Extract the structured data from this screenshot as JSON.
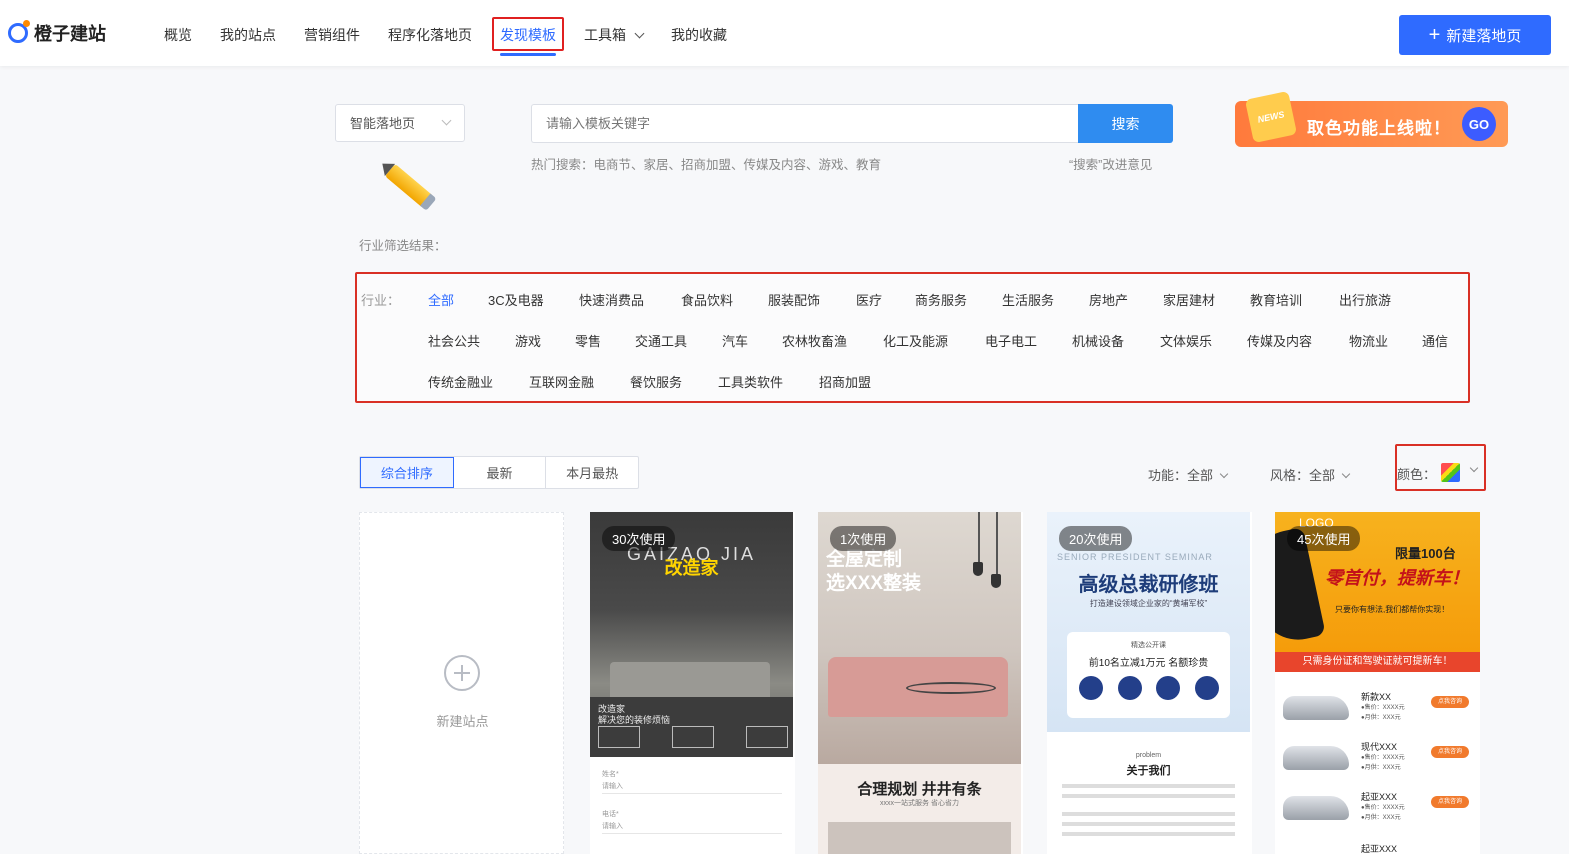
{
  "header": {
    "logo_text": "橙子建站",
    "nav": [
      "概览",
      "我的站点",
      "营销组件",
      "程序化落地页",
      "发现模板",
      "工具箱",
      "我的收藏"
    ],
    "active_nav": "发现模板",
    "new_button": "新建落地页"
  },
  "search": {
    "scope_select": "智能落地页",
    "placeholder": "请输入模板关键字",
    "button": "搜索",
    "hot_label": "热门搜索：电商节、家居、招商加盟、传媒及内容、游戏、教育",
    "feedback": "“搜索”改进意见"
  },
  "promo": {
    "badge": "NEWS",
    "text": "取色功能上线啦！",
    "go": "GO"
  },
  "filter_result_label": "行业筛选结果：",
  "industry": {
    "label": "行业：",
    "active": "全部",
    "rows": [
      [
        "全部",
        "3C及电器",
        "快速消费品",
        "食品饮料",
        "服装配饰",
        "医疗",
        "商务服务",
        "生活服务",
        "房地产",
        "家居建材",
        "教育培训",
        "出行旅游"
      ],
      [
        "社会公共",
        "游戏",
        "零售",
        "交通工具",
        "汽车",
        "农林牧畜渔",
        "化工及能源",
        "电子电工",
        "机械设备",
        "文体娱乐",
        "传媒及内容",
        "物流业",
        "通信"
      ],
      [
        "传统金融业",
        "互联网金融",
        "餐饮服务",
        "工具类软件",
        "招商加盟"
      ]
    ]
  },
  "sort": {
    "options": [
      "综合排序",
      "最新",
      "本月最热"
    ],
    "active": "综合排序"
  },
  "filters": {
    "function_label": "功能：全部",
    "style_label": "风格：全部",
    "color_label": "颜色："
  },
  "new_site": {
    "label": "新建站点"
  },
  "templates": [
    {
      "badge": "30次使用",
      "brand": "GAIZAO JIA",
      "brand_cn": "改造家",
      "caption1": "改造家",
      "caption2": "解决您的装修烦恼",
      "form_fields": [
        "姓名*",
        "电话*"
      ],
      "form_placeholder": "请输入"
    },
    {
      "badge": "1次使用",
      "headline1": "全屋定制",
      "headline2": "选XXX整装",
      "panel_title": "合理规划 井井有条",
      "panel_sub": "xxxx一站式服务 省心省力"
    },
    {
      "badge": "20次使用",
      "en": "SENIOR PRESIDENT SEMINAR",
      "title": "高级总裁研修班",
      "sub": "打造建设领域企业家的“黄埔军校”",
      "box1": "精选公开课",
      "box2": "前10名立减1万元  名额珍贵",
      "pb": "problem",
      "about": "关于我们"
    },
    {
      "badge": "45次使用",
      "logo": "LOGO",
      "limit": "限量100台",
      "headline": "零首付，提新车！",
      "sub": "只要你有想法,我们都帮你实现！",
      "bar": "只需身份证和驾驶证就可提新车！",
      "cars": [
        {
          "name": "新款XX",
          "price": "●售价：XXXX元",
          "price2": "●月供：XXX元",
          "cta": "点我咨询"
        },
        {
          "name": "现代XXX",
          "price": "●售价：XXXX元",
          "price2": "●月供：XXX元",
          "cta": "点我咨询"
        },
        {
          "name": "起亚XXX",
          "price": "●售价：XXXX元",
          "price2": "●月供：XXX元",
          "cta": "点我咨询"
        }
      ],
      "last_name": "起亚XXX"
    }
  ]
}
